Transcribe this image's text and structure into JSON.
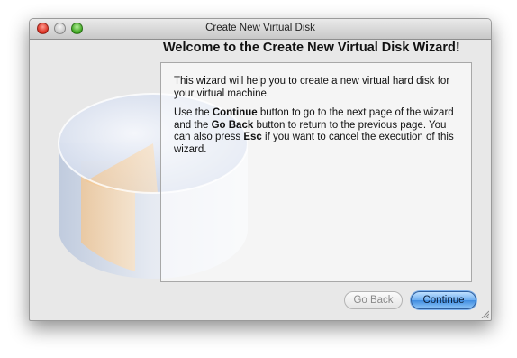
{
  "window": {
    "title": "Create New Virtual Disk"
  },
  "wizard": {
    "heading": "Welcome to the Create New Virtual Disk Wizard!",
    "paragraph1": "This wizard will help you to create a new virtual hard disk for your virtual machine.",
    "p2_part1": "Use the ",
    "p2_continue": "Continue",
    "p2_part2": " button to go to the next page of the wizard and the ",
    "p2_goback": "Go Back",
    "p2_part3": " button to return to the previous page. You can also press ",
    "p2_esc": "Esc",
    "p2_part4": " if you want to cancel the execution of this wizard."
  },
  "buttons": {
    "go_back": "Go Back",
    "continue": "Continue"
  },
  "icons": {
    "traffic_lights": [
      "close-icon",
      "minimize-icon",
      "zoom-icon"
    ],
    "illustration": "disk-illustration",
    "resize": "resize-grip-icon"
  }
}
